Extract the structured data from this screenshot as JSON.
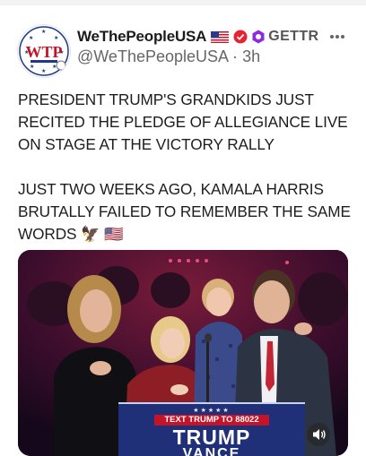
{
  "post": {
    "display_name": "WeThePeopleUSA",
    "platform_label": "GETTR",
    "handle": "@WeThePeopleUSA",
    "separator": "·",
    "time_ago": "3h",
    "avatar_text": "WTP",
    "paragraphs": [
      "PRESIDENT TRUMP'S GRANDKIDS JUST RECITED THE PLEDGE OF ALLEGIANCE LIVE ON STAGE AT THE VICTORY RALLY",
      "JUST TWO WEEKS AGO, KAMALA HARRIS BRUTALLY FAILED TO REMEMBER THE SAME WORDS 🦅 🇺🇸"
    ]
  },
  "media": {
    "sign_banner": "TEXT TRUMP TO 88022",
    "sign_line1": "TRUMP",
    "sign_line2": "VANCE"
  },
  "icons": {
    "flag": "us-flag-icon",
    "verified": "verified-badge-icon",
    "gettr": "gettr-logo-icon",
    "more": "more-options-icon",
    "audio": "speaker-icon"
  },
  "colors": {
    "sign_blue": "#1f2f78",
    "sign_red": "#c4142a",
    "verified_red": "#e8232f",
    "gettr_purple": "#8a2be2"
  }
}
